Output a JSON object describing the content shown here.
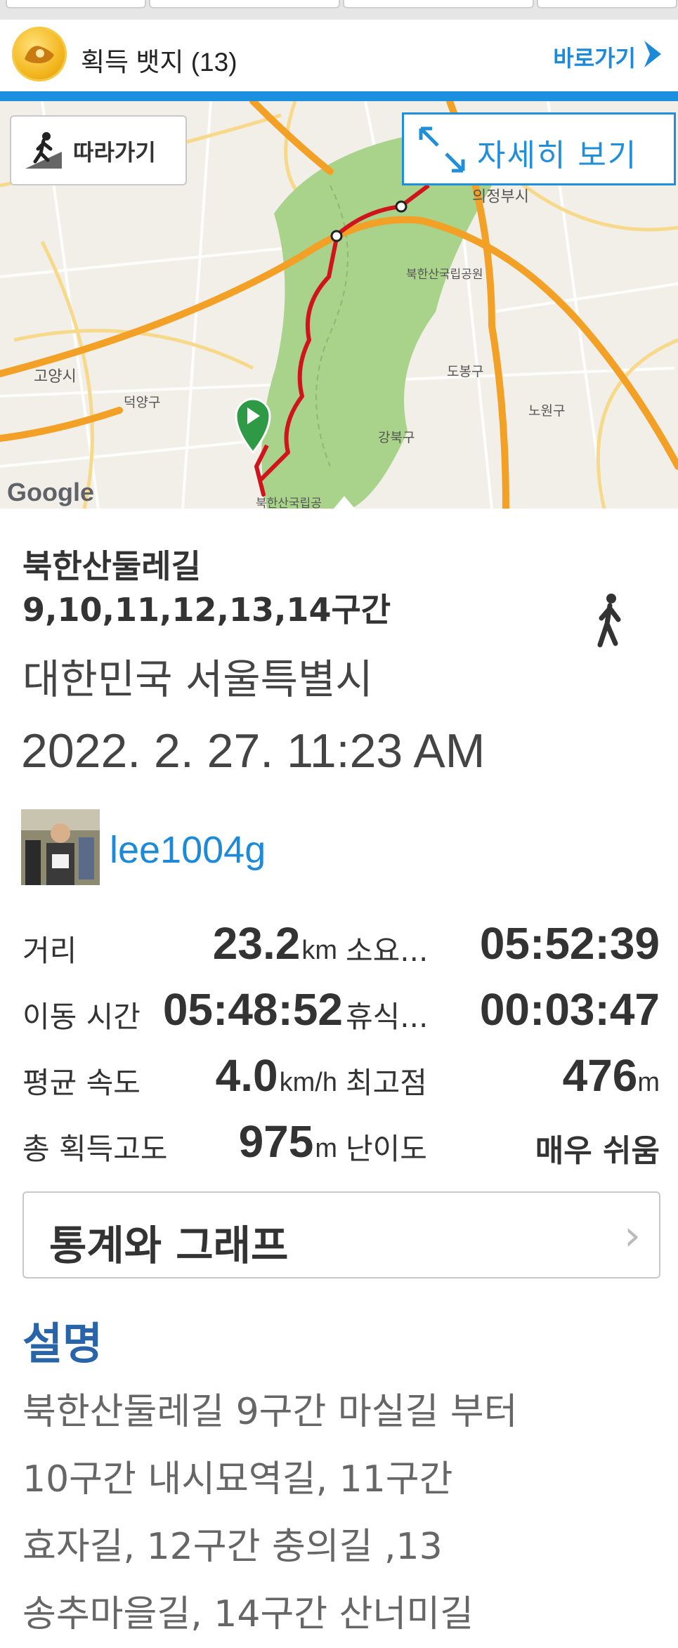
{
  "badges": {
    "label": "획득 뱃지 (13)",
    "goto": "바로가기"
  },
  "map": {
    "follow_label": "따라가기",
    "detail_label": "자세히 보기",
    "places": [
      "의정부시",
      "북한산국립공원",
      "고양시",
      "덕양구",
      "도봉구",
      "노원구",
      "강북구",
      "북한산국립공"
    ],
    "provider": "Google",
    "colors": {
      "route": "#d0141c",
      "park": "#a9d28a",
      "highway": "#f2a026",
      "accent": "#1d8fe1"
    }
  },
  "activity": {
    "title_line1": "북한산둘레길",
    "title_line2": "9,10,11,12,13,14구간",
    "activity_icon": "walking-icon",
    "location": "대한민국 서울특별시",
    "datetime": "2022. 2. 27. 11:23 AM",
    "user": "lee1004g"
  },
  "stats": [
    {
      "label": "거리",
      "value": "23.2",
      "unit": "km",
      "label2": "소요...",
      "value2": "05:52:39",
      "unit2": ""
    },
    {
      "label": "이동 시간",
      "value": "05:48:52",
      "unit": "",
      "label2": "휴식...",
      "value2": "00:03:47",
      "unit2": ""
    },
    {
      "label": "평균 속도",
      "value": "4.0",
      "unit": "km/h",
      "label2": "최고점",
      "value2": "476",
      "unit2": "m"
    },
    {
      "label": "총 획득고도",
      "value": "975",
      "unit": "m",
      "label2": "난이도",
      "value2": "매우 쉬움",
      "unit2": ""
    }
  ],
  "graph_button": "통계와 그래프",
  "description": {
    "heading": "설명",
    "lines": [
      "북한산둘레길 9구간 마실길 부터",
      "10구간 내시묘역길, 11구간",
      "효자길, 12구간 충의길 ,13",
      "송추마을길, 14구간 산너미길"
    ]
  }
}
